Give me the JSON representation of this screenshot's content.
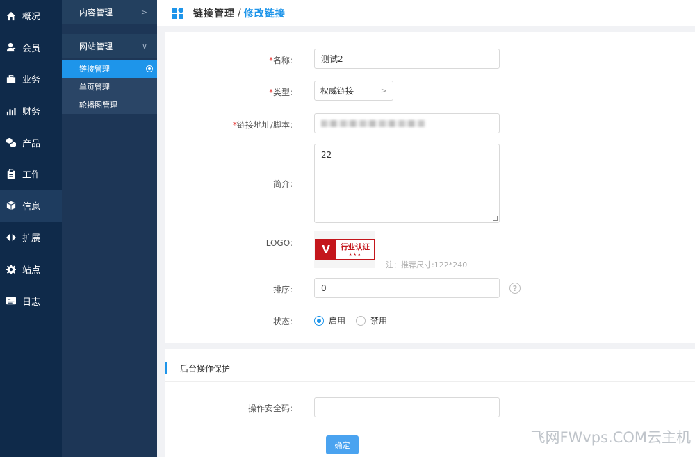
{
  "sidebar_primary": [
    {
      "label": "概况",
      "icon": "home-icon"
    },
    {
      "label": "会员",
      "icon": "user-icon"
    },
    {
      "label": "业务",
      "icon": "briefcase-icon"
    },
    {
      "label": "财务",
      "icon": "bar-chart-icon"
    },
    {
      "label": "产品",
      "icon": "cubes-icon"
    },
    {
      "label": "工作",
      "icon": "clipboard-icon"
    },
    {
      "label": "信息",
      "icon": "box-icon",
      "active": true
    },
    {
      "label": "扩展",
      "icon": "code-arrows-icon"
    },
    {
      "label": "站点",
      "icon": "gear-icon"
    },
    {
      "label": "日志",
      "icon": "log-card-icon"
    }
  ],
  "sidebar_secondary": {
    "groups": [
      {
        "label": "内容管理",
        "arrow": ">"
      },
      {
        "label": "网站管理",
        "arrow": "∨"
      }
    ],
    "subitems": [
      {
        "label": "链接管理",
        "active": true
      },
      {
        "label": "单页管理"
      },
      {
        "label": "轮播图管理"
      }
    ]
  },
  "header": {
    "title": "链接管理",
    "separator": "/",
    "subtitle": "修改链接"
  },
  "form": {
    "name": {
      "required": "*",
      "label": "名称:",
      "value": "测试2"
    },
    "type": {
      "required": "*",
      "label": "类型:",
      "value": "权威链接",
      "chevron": ">"
    },
    "url": {
      "required": "*",
      "label": "链接地址/脚本:"
    },
    "intro": {
      "label": "简介:",
      "value": "22"
    },
    "logo": {
      "label": "LOGO:",
      "logo_letter": "V",
      "logo_text": "行业认证",
      "logo_stars": "★★★",
      "hint": "注：推荐尺寸:122*240"
    },
    "sort": {
      "label": "排序:",
      "value": "0",
      "help": "?"
    },
    "status": {
      "label": "状态:",
      "options": [
        "启用",
        "禁用"
      ],
      "selected": "启用"
    }
  },
  "protect": {
    "title": "后台操作保护",
    "code_label": "操作安全码:",
    "code_value": "",
    "submit_label": "确定"
  },
  "watermark": "飞网FWvps.COM云主机"
}
